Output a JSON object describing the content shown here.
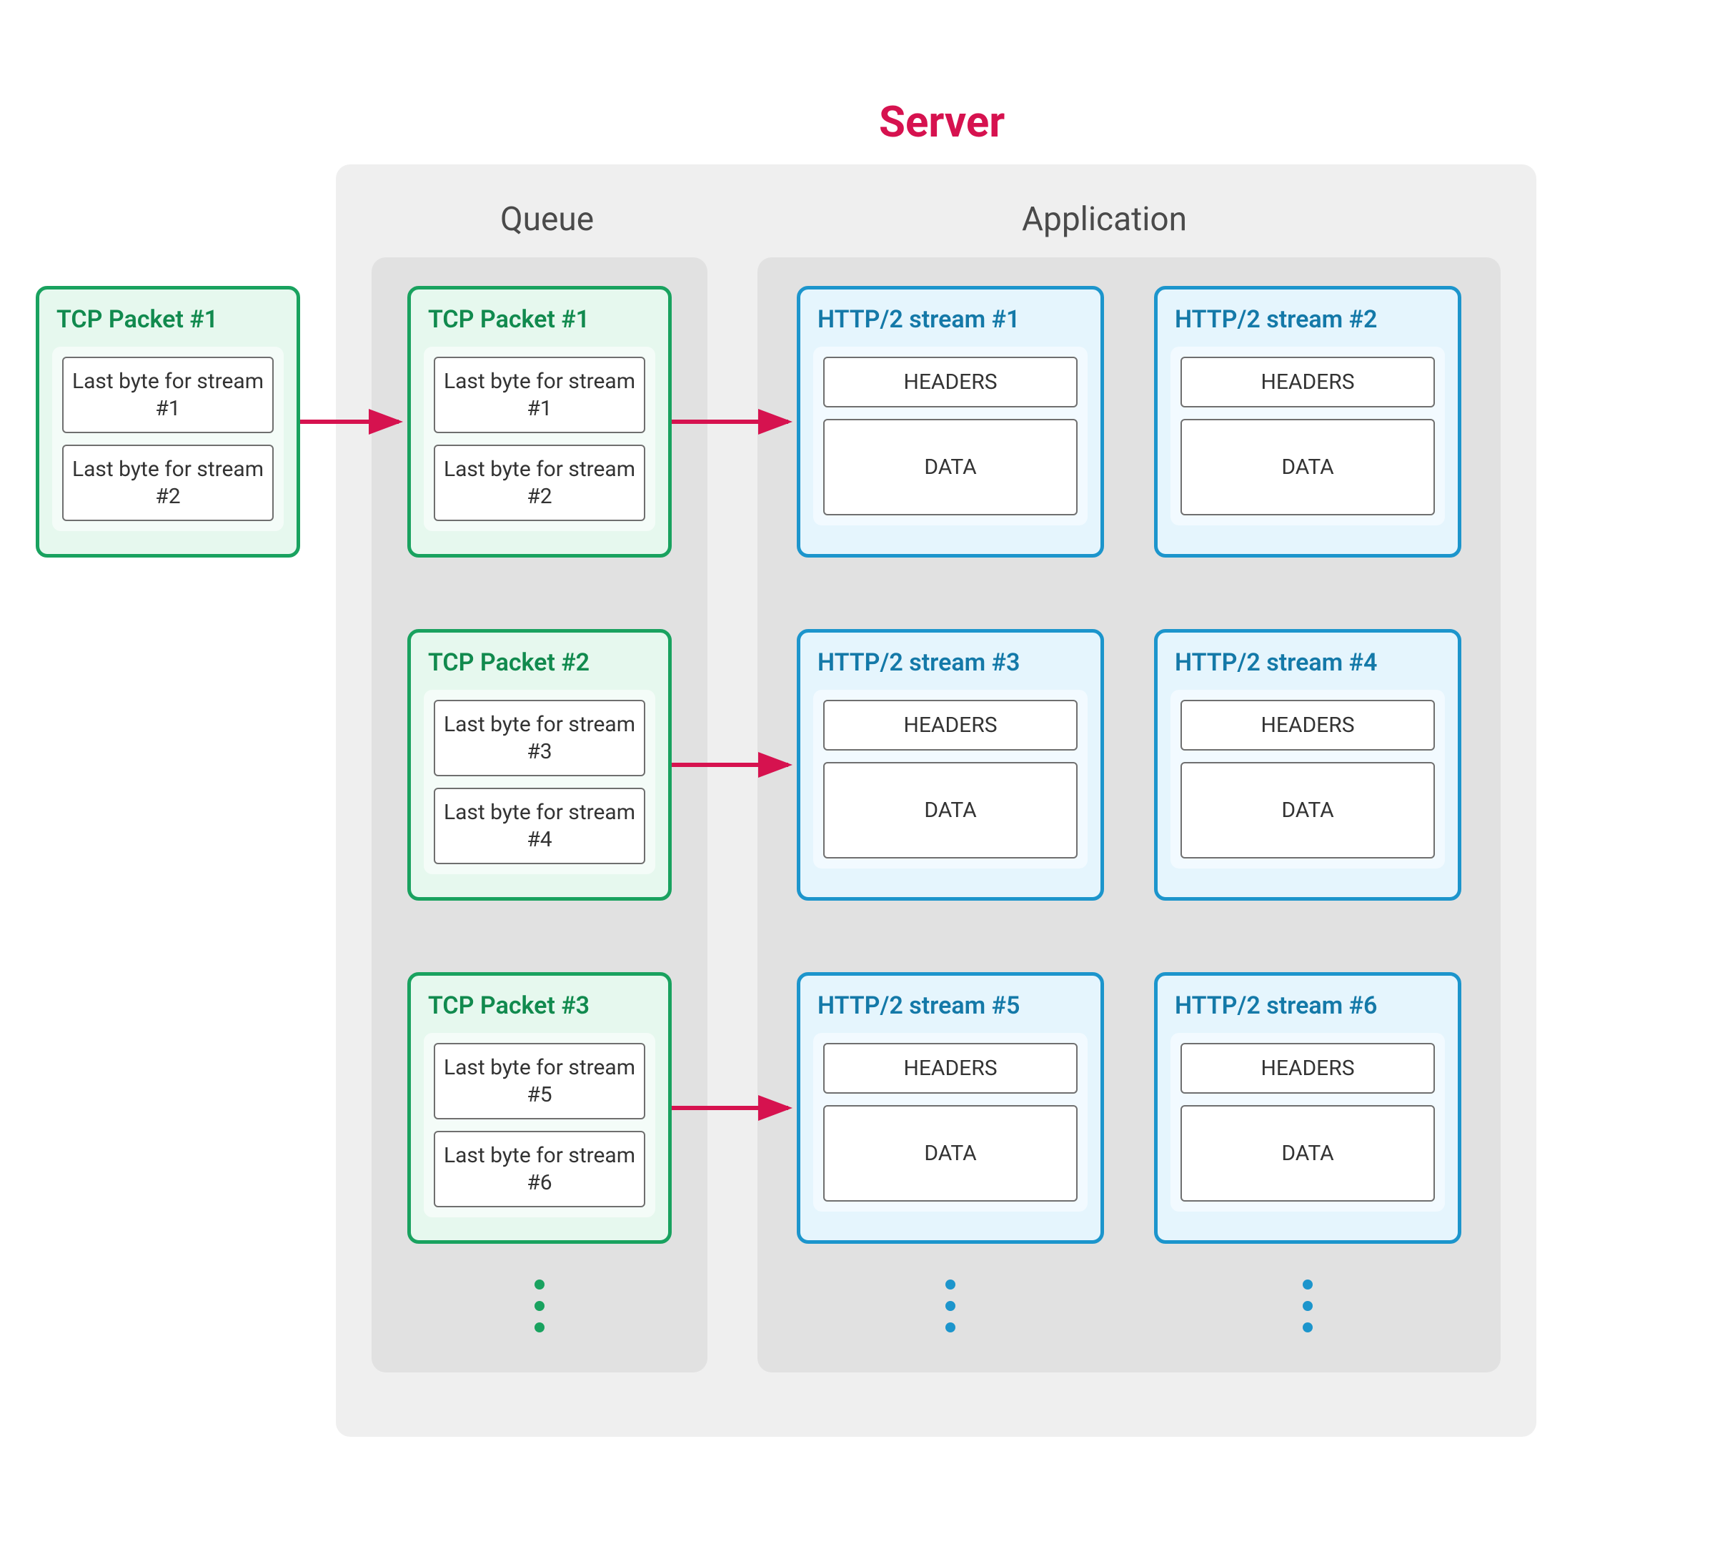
{
  "title": "Server",
  "sections": {
    "queue": "Queue",
    "application": "Application"
  },
  "external_packet": {
    "title": "TCP Packet #1",
    "bytes": [
      "Last byte for stream #1",
      "Last byte for stream #2"
    ]
  },
  "queue_packets": [
    {
      "title": "TCP Packet #1",
      "bytes": [
        "Last byte for stream #1",
        "Last byte for stream #2"
      ]
    },
    {
      "title": "TCP Packet #2",
      "bytes": [
        "Last byte for stream #3",
        "Last byte for stream #4"
      ]
    },
    {
      "title": "TCP Packet #3",
      "bytes": [
        "Last byte for stream #5",
        "Last byte for stream #6"
      ]
    }
  ],
  "streams": [
    {
      "title": "HTTP/2 stream #1",
      "headers": "HEADERS",
      "data": "DATA"
    },
    {
      "title": "HTTP/2 stream #2",
      "headers": "HEADERS",
      "data": "DATA"
    },
    {
      "title": "HTTP/2 stream #3",
      "headers": "HEADERS",
      "data": "DATA"
    },
    {
      "title": "HTTP/2 stream #4",
      "headers": "HEADERS",
      "data": "DATA"
    },
    {
      "title": "HTTP/2 stream #5",
      "headers": "HEADERS",
      "data": "DATA"
    },
    {
      "title": "HTTP/2 stream #6",
      "headers": "HEADERS",
      "data": "DATA"
    }
  ],
  "colors": {
    "accent_red": "#d6124f",
    "green": "#19a25f",
    "blue": "#1c95cc",
    "panel_bg": "#efefef",
    "subpanel_bg": "#e1e1e1"
  }
}
